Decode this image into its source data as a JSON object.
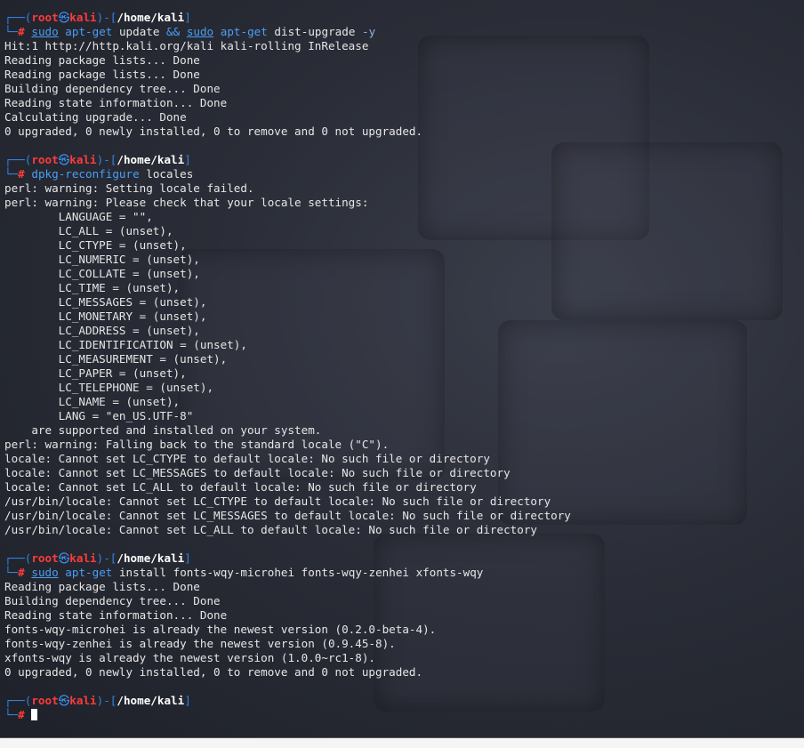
{
  "prompt": {
    "top_open": "┌──(",
    "root": "root",
    "skull": "㉿",
    "host": "kali",
    "mid": ")-[",
    "path": "/home/kali",
    "close": "]",
    "bottom": "└─",
    "hash": "#"
  },
  "blocks": [
    {
      "command": {
        "tokens": [
          {
            "text": "sudo",
            "style": "cmd-ul"
          },
          {
            "text": " ",
            "style": "arg"
          },
          {
            "text": "apt-get",
            "style": "cmd"
          },
          {
            "text": " update ",
            "style": "arg"
          },
          {
            "text": "&&",
            "style": "cmd"
          },
          {
            "text": " ",
            "style": "arg"
          },
          {
            "text": "sudo",
            "style": "cmd-ul"
          },
          {
            "text": " ",
            "style": "arg"
          },
          {
            "text": "apt-get",
            "style": "cmd"
          },
          {
            "text": " dist-upgrade ",
            "style": "arg"
          },
          {
            "text": "-y",
            "style": "opt"
          }
        ]
      },
      "output": [
        "Hit:1 http://http.kali.org/kali kali-rolling InRelease",
        "Reading package lists... Done",
        "Reading package lists... Done",
        "Building dependency tree... Done",
        "Reading state information... Done",
        "Calculating upgrade... Done",
        "0 upgraded, 0 newly installed, 0 to remove and 0 not upgraded."
      ]
    },
    {
      "command": {
        "tokens": [
          {
            "text": "dpkg-reconfigure",
            "style": "cmd"
          },
          {
            "text": " locales",
            "style": "arg"
          }
        ]
      },
      "output": [
        "perl: warning: Setting locale failed.",
        "perl: warning: Please check that your locale settings:",
        "        LANGUAGE = \"\",",
        "        LC_ALL = (unset),",
        "        LC_CTYPE = (unset),",
        "        LC_NUMERIC = (unset),",
        "        LC_COLLATE = (unset),",
        "        LC_TIME = (unset),",
        "        LC_MESSAGES = (unset),",
        "        LC_MONETARY = (unset),",
        "        LC_ADDRESS = (unset),",
        "        LC_IDENTIFICATION = (unset),",
        "        LC_MEASUREMENT = (unset),",
        "        LC_PAPER = (unset),",
        "        LC_TELEPHONE = (unset),",
        "        LC_NAME = (unset),",
        "        LANG = \"en_US.UTF-8\"",
        "    are supported and installed on your system.",
        "perl: warning: Falling back to the standard locale (\"C\").",
        "locale: Cannot set LC_CTYPE to default locale: No such file or directory",
        "locale: Cannot set LC_MESSAGES to default locale: No such file or directory",
        "locale: Cannot set LC_ALL to default locale: No such file or directory",
        "/usr/bin/locale: Cannot set LC_CTYPE to default locale: No such file or directory",
        "/usr/bin/locale: Cannot set LC_MESSAGES to default locale: No such file or directory",
        "/usr/bin/locale: Cannot set LC_ALL to default locale: No such file or directory"
      ]
    },
    {
      "command": {
        "tokens": [
          {
            "text": "sudo",
            "style": "cmd-ul"
          },
          {
            "text": " ",
            "style": "arg"
          },
          {
            "text": "apt-get",
            "style": "cmd"
          },
          {
            "text": " install fonts-wqy-microhei fonts-wqy-zenhei xfonts-wqy",
            "style": "arg"
          }
        ]
      },
      "output": [
        "Reading package lists... Done",
        "Building dependency tree... Done",
        "Reading state information... Done",
        "fonts-wqy-microhei is already the newest version (0.2.0-beta-4).",
        "fonts-wqy-zenhei is already the newest version (0.9.45-8).",
        "xfonts-wqy is already the newest version (1.0.0~rc1-8).",
        "0 upgraded, 0 newly installed, 0 to remove and 0 not upgraded."
      ]
    }
  ],
  "colors": {
    "prompt_frame": "#2f84e6",
    "user_host": "#ff3b3b",
    "command": "#4a9ff5",
    "text": "#e6e6e6",
    "background": "#2a2d37"
  }
}
